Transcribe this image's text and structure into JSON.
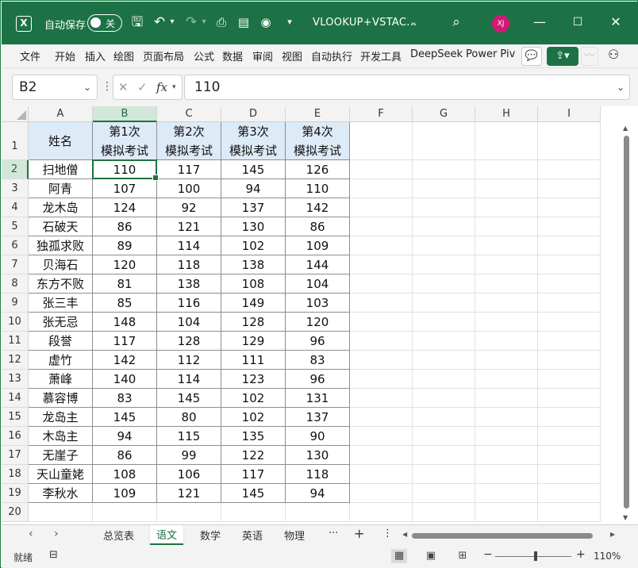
{
  "titlebar": {
    "autosave_label": "自动保存",
    "toggle_state": "关",
    "doc_title": "VLOOKUP+VSTAC...",
    "avatar_initials": "XJ",
    "accent_color": "#1d7245"
  },
  "ribbon": {
    "tabs": [
      "文件",
      "开始",
      "插入",
      "绘图",
      "页面布局",
      "公式",
      "数据",
      "审阅",
      "视图",
      "自动执行",
      "开发工具",
      "DeepSeek",
      "Power Piv"
    ]
  },
  "formula_bar": {
    "name_box": "B2",
    "formula": "110"
  },
  "grid": {
    "columns": [
      "A",
      "B",
      "C",
      "D",
      "E",
      "F",
      "G",
      "H",
      "I"
    ],
    "rows": [
      "1",
      "2",
      "3",
      "4",
      "5",
      "6",
      "7",
      "8",
      "9",
      "10",
      "11",
      "12",
      "13",
      "14",
      "15",
      "16",
      "17",
      "18",
      "19",
      "20"
    ],
    "selected_cell": "B2",
    "header": {
      "name": "姓名",
      "exam1_line1": "第1次",
      "exam1_line2": "模拟考试",
      "exam2_line1": "第2次",
      "exam2_line2": "模拟考试",
      "exam3_line1": "第3次",
      "exam3_line2": "模拟考试",
      "exam4_line1": "第4次",
      "exam4_line2": "模拟考试",
      "fill_color": "#ddebf7"
    },
    "data": [
      [
        "扫地僧",
        "110",
        "117",
        "145",
        "126"
      ],
      [
        "阿青",
        "107",
        "100",
        "94",
        "110"
      ],
      [
        "龙木岛",
        "124",
        "92",
        "137",
        "142"
      ],
      [
        "石破天",
        "86",
        "121",
        "130",
        "86"
      ],
      [
        "独孤求败",
        "89",
        "114",
        "102",
        "109"
      ],
      [
        "贝海石",
        "120",
        "118",
        "138",
        "144"
      ],
      [
        "东方不败",
        "81",
        "138",
        "108",
        "104"
      ],
      [
        "张三丰",
        "85",
        "116",
        "149",
        "103"
      ],
      [
        "张无忌",
        "148",
        "104",
        "128",
        "120"
      ],
      [
        "段誉",
        "117",
        "128",
        "129",
        "96"
      ],
      [
        "虚竹",
        "142",
        "112",
        "111",
        "83"
      ],
      [
        "萧峰",
        "140",
        "114",
        "123",
        "96"
      ],
      [
        "慕容博",
        "83",
        "145",
        "102",
        "131"
      ],
      [
        "龙岛主",
        "145",
        "80",
        "102",
        "137"
      ],
      [
        "木岛主",
        "94",
        "115",
        "135",
        "90"
      ],
      [
        "无崖子",
        "86",
        "99",
        "122",
        "130"
      ],
      [
        "天山童姥",
        "108",
        "106",
        "117",
        "118"
      ],
      [
        "李秋水",
        "109",
        "121",
        "145",
        "94"
      ]
    ]
  },
  "sheets": {
    "tabs": [
      "总览表",
      "语文",
      "数学",
      "英语",
      "物理"
    ],
    "active": "语文",
    "more": "···",
    "add": "+"
  },
  "status": {
    "ready": "就绪",
    "zoom": "110%"
  }
}
